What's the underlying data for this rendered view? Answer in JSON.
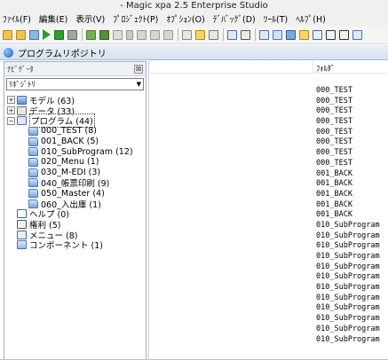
{
  "window": {
    "title": "- Magic xpa 2.5 Enterprise Studio"
  },
  "menubar": {
    "items": [
      "ﾌｧｲﾙ(F)",
      "編集(E)",
      "表示(V)",
      "ﾌﾟﾛｼﾞｪｸﾄ(P)",
      "ｵﾌﾟｼｮﾝ(O)",
      "ﾃﾞﾊﾞｯｸﾞ(D)",
      "ﾂｰﾙ(T)",
      "ﾍﾙﾌﾟ(H)"
    ]
  },
  "doc_tab": {
    "label": "プログラムリポジトリ"
  },
  "navigator": {
    "title": "ﾅﾋﾞｹﾞｰﾀ",
    "close_glyph": "⊠",
    "combo_value": "ﾘﾎﾟｼﾞﾄﾘ",
    "tree": [
      {
        "label": "モデル (63)",
        "icon": "model-icon",
        "expander": "+"
      },
      {
        "label": "データ (33)",
        "icon": "data-icon",
        "expander": "+"
      },
      {
        "label": "プログラム (44)",
        "icon": "program-icon",
        "expander": "−",
        "selected": true
      },
      {
        "label": "000_TEST (8)",
        "icon": "folder-icon"
      },
      {
        "label": "001_BACK (5)",
        "icon": "folder-icon"
      },
      {
        "label": "010_SubProgram (12)",
        "icon": "folder-icon"
      },
      {
        "label": "020_Menu (1)",
        "icon": "folder-icon"
      },
      {
        "label": "030_M-EDI (3)",
        "icon": "folder-icon"
      },
      {
        "label": "040_帳票印刷 (9)",
        "icon": "folder-icon"
      },
      {
        "label": "050_Master (4)",
        "icon": "folder-icon"
      },
      {
        "label": "060_入出庫 (1)",
        "icon": "folder-icon"
      },
      {
        "label": "ヘルプ (0)",
        "icon": "help-icon"
      },
      {
        "label": "権利 (5)",
        "icon": "rights-icon"
      },
      {
        "label": "メニュー (8)",
        "icon": "menu-icon"
      },
      {
        "label": "コンポーネント (1)",
        "icon": "component-icon"
      }
    ]
  },
  "list": {
    "folder_header": "ﾌｫﾙﾀﾞ",
    "rows": [
      "000_TEST",
      "000_TEST",
      "000_TEST",
      "000_TEST",
      "000_TEST",
      "000_TEST",
      "000_TEST",
      "000_TEST",
      "001_BACK",
      "001_BACK",
      "001_BACK",
      "001_BACK",
      "001_BACK",
      "010_SubProgram",
      "010_SubProgram",
      "010_SubProgram",
      "010_SubProgram",
      "010_SubProgram",
      "010_SubProgram",
      "010_SubProgram",
      "010_SubProgram",
      "010_SubProgram",
      "010_SubProgram",
      "010_SubProgram",
      "010_SubProgram"
    ]
  },
  "colors": {
    "accent": "#1f5fbf",
    "tab_gradient_top": "#e9eef6",
    "panel_border": "#9fb0c8"
  }
}
